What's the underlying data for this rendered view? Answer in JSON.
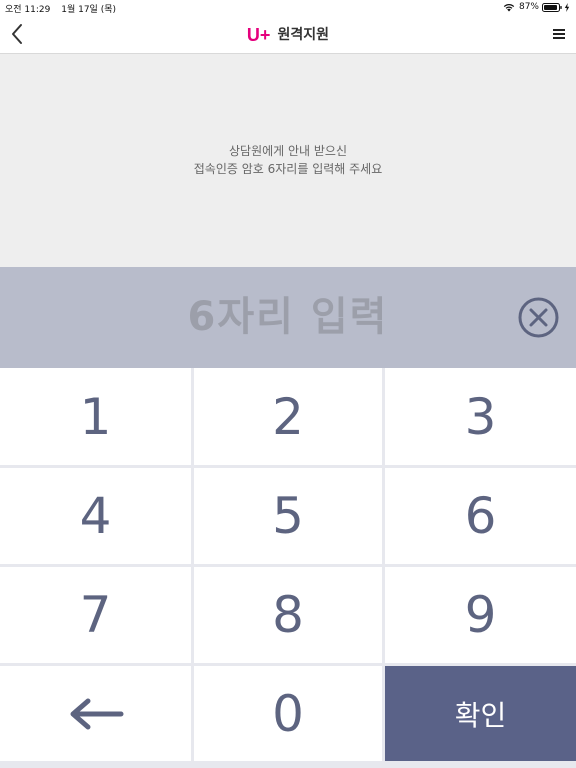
{
  "status_bar": {
    "time": "오전 11:29",
    "date": "1월 17일 (목)",
    "battery": "87%",
    "icons": [
      "wifi-icon",
      "battery-icon",
      "charging-bolt-icon"
    ]
  },
  "nav": {
    "back_icon": "chevron-left-icon",
    "brand_logo": "U+",
    "title": "원격지원",
    "menu_icon": "hamburger-menu-icon",
    "brand_color": "#e5007d"
  },
  "instruction": {
    "line1": "상담원에게 안내 받으신",
    "line2": "접속인증 암호 6자리를 입력해 주세요"
  },
  "code_entry": {
    "placeholder": "6자리 입력",
    "clear_icon": "circle-x-icon"
  },
  "keypad": {
    "keys": [
      "1",
      "2",
      "3",
      "4",
      "5",
      "6",
      "7",
      "8",
      "9"
    ],
    "backspace_icon": "arrow-left-icon",
    "zero": "0",
    "confirm_label": "확인"
  },
  "colors": {
    "key_text": "#5d6480",
    "confirm_bg": "#5a6288",
    "entry_bg": "#b8bccb",
    "instruction_bg": "#eeeeee"
  }
}
